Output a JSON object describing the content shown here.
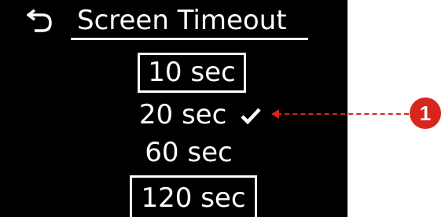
{
  "header": {
    "title": "Screen Timeout",
    "back_icon": "back-arrow-icon"
  },
  "options": [
    {
      "label": "10 sec",
      "boxed": true,
      "selected": false
    },
    {
      "label": "20 sec",
      "boxed": false,
      "selected": true
    },
    {
      "label": "60 sec",
      "boxed": false,
      "selected": false
    },
    {
      "label": "120 sec",
      "boxed": true,
      "selected": false
    }
  ],
  "selected_indicator": "checkmark-icon",
  "callout": {
    "number": "1",
    "color": "#d9261c"
  },
  "colors": {
    "screen_background": "#000000",
    "text": "#ffffff",
    "callout": "#d9261c"
  }
}
